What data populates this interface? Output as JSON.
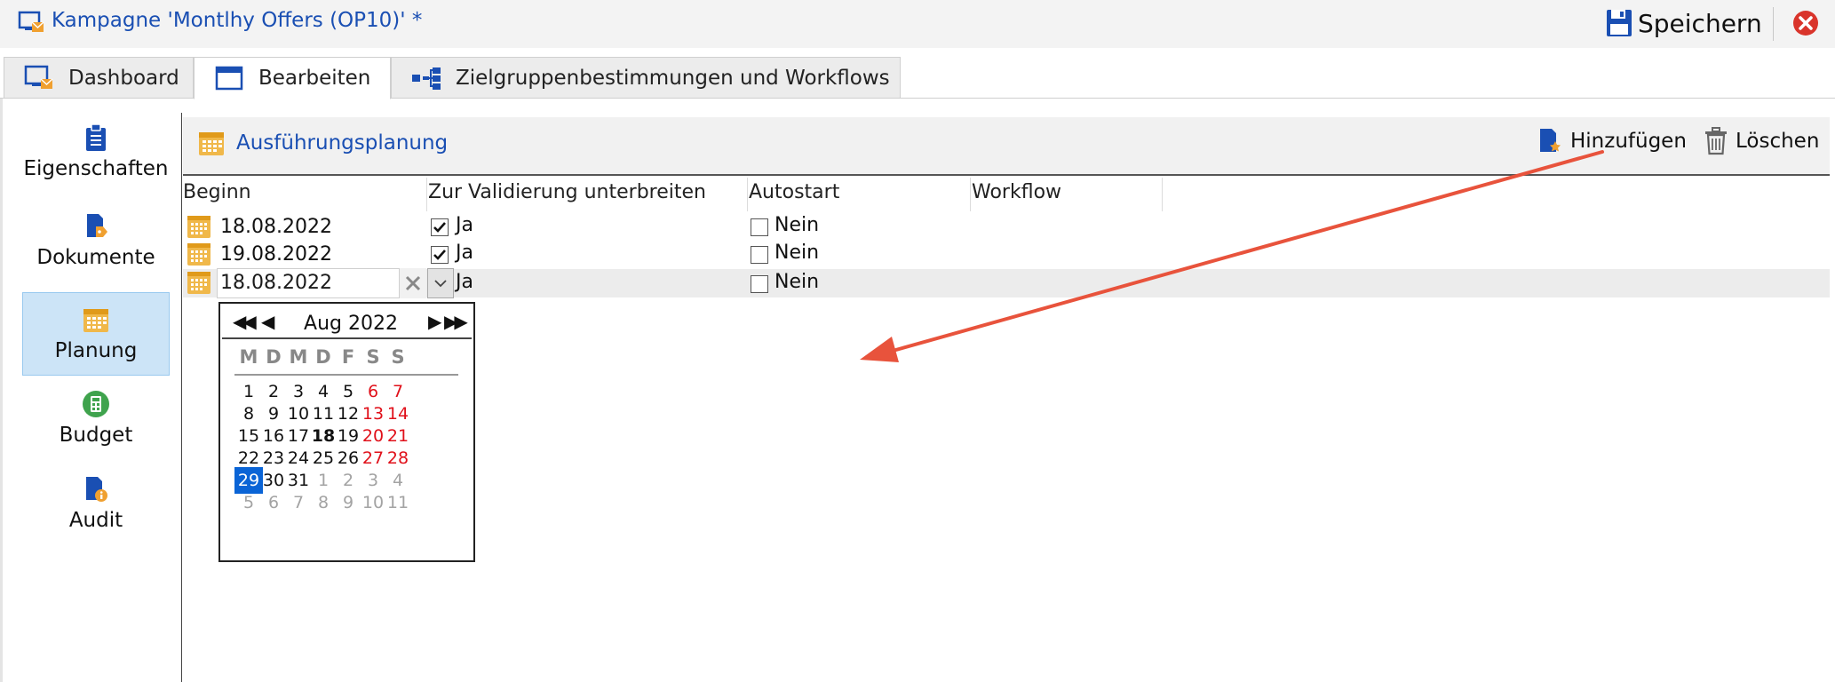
{
  "window": {
    "title": "Kampagne 'Montlhy Offers (OP10)' *",
    "save_label": "Speichern",
    "accent_color": "#1a4fb3",
    "close_color": "#d9342b"
  },
  "tabs": [
    {
      "label": "Dashboard",
      "icon": "monitor-envelope-icon"
    },
    {
      "label": "Bearbeiten",
      "icon": "window-icon",
      "active": true
    },
    {
      "label": "Zielgruppenbestimmungen und Workflows",
      "icon": "workflow-icon"
    }
  ],
  "sidebar": {
    "items": [
      {
        "label": "Eigenschaften",
        "icon": "clipboard-icon"
      },
      {
        "label": "Dokumente",
        "icon": "document-tag-icon"
      },
      {
        "label": "Planung",
        "icon": "calendar-icon",
        "active": true
      },
      {
        "label": "Budget",
        "icon": "calculator-icon"
      },
      {
        "label": "Audit",
        "icon": "document-info-icon"
      }
    ]
  },
  "toolbar": {
    "title": "Ausführungsplanung",
    "add_label": "Hinzufügen",
    "delete_label": "Löschen"
  },
  "grid": {
    "columns": [
      "Beginn",
      "Zur Validierung unterbreiten",
      "Autostart",
      "Workflow"
    ],
    "rows": [
      {
        "beginn": "18.08.2022",
        "validation_checked": true,
        "validation_label": "Ja",
        "autostart_checked": false,
        "autostart_label": "Nein"
      },
      {
        "beginn": "19.08.2022",
        "validation_checked": true,
        "validation_label": "Ja",
        "autostart_checked": false,
        "autostart_label": "Nein"
      },
      {
        "beginn": "18.08.2022",
        "validation_checked": false,
        "validation_label": "Ja",
        "autostart_checked": false,
        "autostart_label": "Nein",
        "editing": true
      }
    ]
  },
  "calendar": {
    "month_label": "Aug 2022",
    "weekday_headers": [
      "M",
      "D",
      "M",
      "D",
      "F",
      "S",
      "S"
    ],
    "weeks": [
      [
        "1",
        "2",
        "3",
        "4",
        "5",
        "6",
        "7"
      ],
      [
        "8",
        "9",
        "10",
        "11",
        "12",
        "13",
        "14"
      ],
      [
        "15",
        "16",
        "17",
        "18",
        "19",
        "20",
        "21"
      ],
      [
        "22",
        "23",
        "24",
        "25",
        "26",
        "27",
        "28"
      ],
      [
        "29",
        "30",
        "31",
        "1",
        "2",
        "3",
        "4"
      ],
      [
        "5",
        "6",
        "7",
        "8",
        "9",
        "10",
        "11"
      ]
    ],
    "selected_day": "29",
    "today_day": "18",
    "weekend_color": "#e0101a",
    "selected_color": "#0a64d6"
  },
  "annotation": {
    "arrow_color": "#e8533c"
  }
}
